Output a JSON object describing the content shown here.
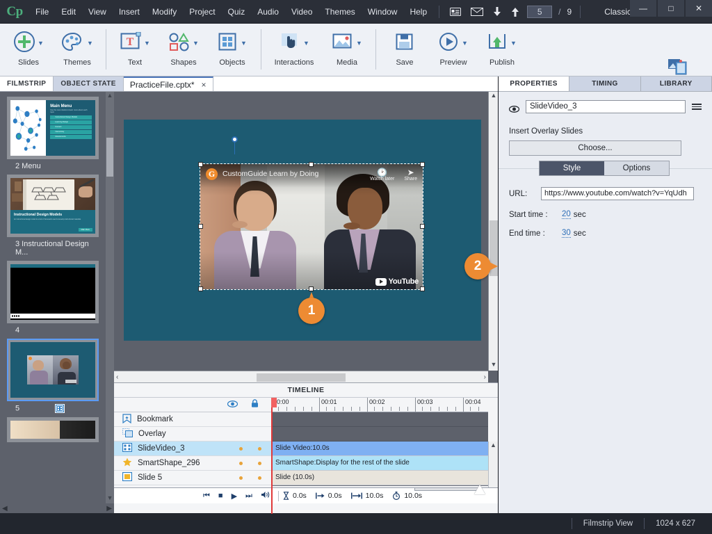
{
  "menubar": {
    "logo": "Cp",
    "items": [
      "File",
      "Edit",
      "View",
      "Insert",
      "Modify",
      "Project",
      "Quiz",
      "Audio",
      "Video",
      "Themes",
      "Window",
      "Help"
    ],
    "icons": [
      "notes-icon",
      "mail-icon",
      "download-icon",
      "upload-icon"
    ],
    "page_current": "5",
    "page_sep": "/",
    "page_total": "9",
    "workspace": "Classic",
    "window_controls": [
      "minimize-button",
      "maximize-button",
      "close-button"
    ]
  },
  "ribbon": {
    "groups": [
      {
        "items": [
          {
            "label": "Slides",
            "icon": "plus-circle-icon",
            "caret": true
          },
          {
            "label": "Themes",
            "icon": "palette-icon",
            "caret": true
          }
        ]
      },
      {
        "items": [
          {
            "label": "Text",
            "icon": "text-box-icon",
            "caret": true
          },
          {
            "label": "Shapes",
            "icon": "shapes-icon",
            "caret": true
          },
          {
            "label": "Objects",
            "icon": "grid-objects-icon",
            "caret": true
          }
        ]
      },
      {
        "items": [
          {
            "label": "Interactions",
            "icon": "hand-pointer-icon",
            "caret": true
          },
          {
            "label": "Media",
            "icon": "image-icon",
            "caret": true
          }
        ]
      },
      {
        "items": [
          {
            "label": "Save",
            "icon": "floppy-disk-icon",
            "caret": false
          },
          {
            "label": "Preview",
            "icon": "play-circle-icon",
            "caret": true
          },
          {
            "label": "Publish",
            "icon": "publish-upload-icon",
            "caret": true
          }
        ]
      }
    ],
    "assets": {
      "label": "Assets",
      "icon": "assets-icon"
    }
  },
  "tabs": {
    "filmstrip": "FILMSTRIP",
    "object_state": "OBJECT STATE",
    "document": "PracticeFile.cptx*",
    "close_glyph": "×"
  },
  "filmstrip": {
    "slides": [
      {
        "number": "2",
        "caption": "2 Menu",
        "selected": false,
        "kind": "menu"
      },
      {
        "number": "3",
        "caption": "3 Instructional Design M...",
        "selected": false,
        "kind": "design"
      },
      {
        "number": "4",
        "caption": "4",
        "selected": false,
        "kind": "black"
      },
      {
        "number": "5",
        "caption": "5",
        "selected": true,
        "kind": "video",
        "badge": "video-badge-icon"
      },
      {
        "number": "6",
        "caption": "",
        "selected": false,
        "kind": "partial"
      }
    ],
    "menu_slide": {
      "title": "Main Menu",
      "subtitle": "Use the menu below to learn more about each topic.",
      "buttons": [
        "Instructional Design Models",
        "Learning Design",
        "Content",
        "Interactivity",
        "Assessments"
      ]
    },
    "design_slide": {
      "title": "Instructional Design Models",
      "subtitle": "An instructional design model is a tool or framework used to develop instructional materials.",
      "button": "Main Menu"
    }
  },
  "stage": {
    "video": {
      "brand_logo": "customguide-logo-icon",
      "brand_text": "CustomGuide Learn by Doing",
      "controls": [
        {
          "label": "Watch later",
          "icon": "clock-icon"
        },
        {
          "label": "Share",
          "icon": "share-arrow-icon"
        }
      ],
      "youtube_label": "YouTube"
    },
    "callouts": [
      {
        "number": "1",
        "name": "callout-1"
      },
      {
        "number": "2",
        "name": "callout-2"
      }
    ],
    "scroll_left_glyph": "‹",
    "scroll_right_glyph": "›",
    "scroll_up_glyph": "⌃",
    "scroll_down_glyph": "⌄"
  },
  "timeline": {
    "title": "TIMELINE",
    "eye_icon": "eye-icon",
    "lock_icon": "lock-icon",
    "rows": [
      {
        "label": "Bookmark",
        "icon": "bookmark-icon",
        "selected": false,
        "has_dots": false,
        "bar": null
      },
      {
        "label": "Overlay",
        "icon": "overlay-icon",
        "selected": false,
        "has_dots": false,
        "bar": null
      },
      {
        "label": "SlideVideo_3",
        "icon": "video-track-icon",
        "selected": true,
        "has_dots": true,
        "bar": {
          "text": "Slide Video:10.0s",
          "color": "#7fb0f2"
        }
      },
      {
        "label": "SmartShape_296",
        "icon": "star-icon",
        "selected": false,
        "has_dots": true,
        "bar": {
          "text": "SmartShape:Display for the rest of the slide",
          "color": "#aee2f7"
        }
      },
      {
        "label": "Slide 5",
        "icon": "slide-square-icon",
        "selected": false,
        "has_dots": true,
        "bar": {
          "text": "Slide (10.0s)",
          "color": "#e8e4dc"
        }
      }
    ],
    "ruler_labels": [
      "00:00",
      "00:01",
      "00:02",
      "00:03",
      "00:04"
    ],
    "transport": [
      {
        "name": "go-to-start-button",
        "glyph": "⏮"
      },
      {
        "name": "stop-button",
        "glyph": "■"
      },
      {
        "name": "play-button",
        "glyph": "▶"
      },
      {
        "name": "go-to-end-button",
        "glyph": "⏭"
      },
      {
        "name": "audio-button",
        "glyph": "◀)"
      }
    ],
    "stats": [
      {
        "name": "delay-stat",
        "icon": "hourglass-icon",
        "value": "0.0s"
      },
      {
        "name": "start-stat",
        "icon": "start-arrow-icon",
        "value": "0.0s"
      },
      {
        "name": "duration-stat",
        "icon": "span-arrow-icon",
        "value": "10.0s"
      },
      {
        "name": "total-stat",
        "icon": "stopwatch-icon",
        "value": "10.0s"
      }
    ]
  },
  "properties": {
    "tabs": [
      {
        "label": "PROPERTIES",
        "active": true
      },
      {
        "label": "TIMING",
        "active": false
      },
      {
        "label": "LIBRARY",
        "active": false
      }
    ],
    "object_name": "SlideVideo_3",
    "eye_icon": "eye-icon",
    "menu_icon": "panel-menu-icon",
    "insert_overlay_label": "Insert Overlay Slides",
    "choose_button": "Choose...",
    "style_tab": "Style",
    "options_tab": "Options",
    "url_label": "URL:",
    "url_value": "https://www.youtube.com/watch?v=YqUdh",
    "start_time_label": "Start time :",
    "start_time_value": "20",
    "start_time_unit": "sec",
    "end_time_label": "End time :",
    "end_time_value": "30",
    "end_time_unit": "sec"
  },
  "statusbar": {
    "view_mode": "Filmstrip View",
    "dimensions": "1024 x 627"
  },
  "colors": {
    "accent_orange": "#ed8b33",
    "slide_teal": "#1d5b72",
    "selection_blue": "#5b9bf5",
    "playhead_red": "#e03a3a"
  }
}
